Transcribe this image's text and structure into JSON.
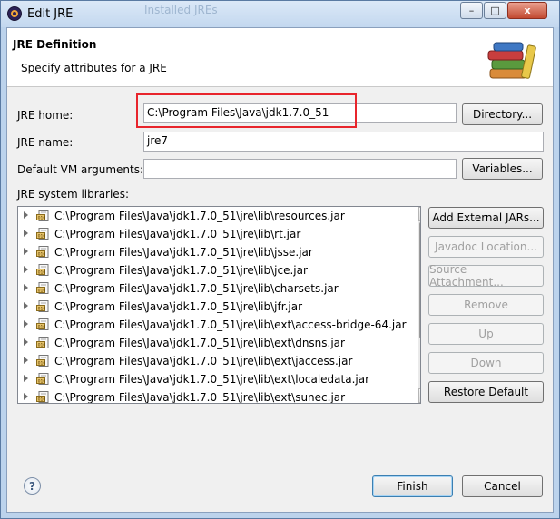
{
  "window": {
    "title": "Edit JRE",
    "background_title": "Installed JREs"
  },
  "titlebar": {
    "minimize": "–",
    "maximize": "□",
    "close": "x"
  },
  "header": {
    "title": "JRE Definition",
    "subtitle": "Specify attributes for a JRE"
  },
  "form": {
    "jre_home_label": "JRE home:",
    "jre_home_value": "C:\\Program Files\\Java\\jdk1.7.0_51",
    "directory_button": "Directory...",
    "jre_name_label": "JRE name:",
    "jre_name_value": "jre7",
    "vm_args_label": "Default VM arguments:",
    "vm_args_value": "",
    "variables_button": "Variables...",
    "libraries_label": "JRE system libraries:"
  },
  "libraries": [
    "C:\\Program Files\\Java\\jdk1.7.0_51\\jre\\lib\\resources.jar",
    "C:\\Program Files\\Java\\jdk1.7.0_51\\jre\\lib\\rt.jar",
    "C:\\Program Files\\Java\\jdk1.7.0_51\\jre\\lib\\jsse.jar",
    "C:\\Program Files\\Java\\jdk1.7.0_51\\jre\\lib\\jce.jar",
    "C:\\Program Files\\Java\\jdk1.7.0_51\\jre\\lib\\charsets.jar",
    "C:\\Program Files\\Java\\jdk1.7.0_51\\jre\\lib\\jfr.jar",
    "C:\\Program Files\\Java\\jdk1.7.0_51\\jre\\lib\\ext\\access-bridge-64.jar",
    "C:\\Program Files\\Java\\jdk1.7.0_51\\jre\\lib\\ext\\dnsns.jar",
    "C:\\Program Files\\Java\\jdk1.7.0_51\\jre\\lib\\ext\\jaccess.jar",
    "C:\\Program Files\\Java\\jdk1.7.0_51\\jre\\lib\\ext\\localedata.jar",
    "C:\\Program Files\\Java\\jdk1.7.0_51\\jre\\lib\\ext\\sunec.jar"
  ],
  "side_buttons": {
    "add_external": "Add External JARs...",
    "javadoc": "Javadoc Location...",
    "source": "Source Attachment...",
    "remove": "Remove",
    "up": "Up",
    "down": "Down",
    "restore": "Restore Default"
  },
  "footer": {
    "help": "?",
    "finish": "Finish",
    "cancel": "Cancel"
  },
  "colors": {
    "highlight_border": "#e8252c",
    "titlebar": "#c3d8ef",
    "dialog_bg": "#f0f0f0"
  },
  "icons": {
    "app": "eclipse-icon",
    "header": "books-icon",
    "jar": "jar-file-icon",
    "help": "help-icon"
  }
}
